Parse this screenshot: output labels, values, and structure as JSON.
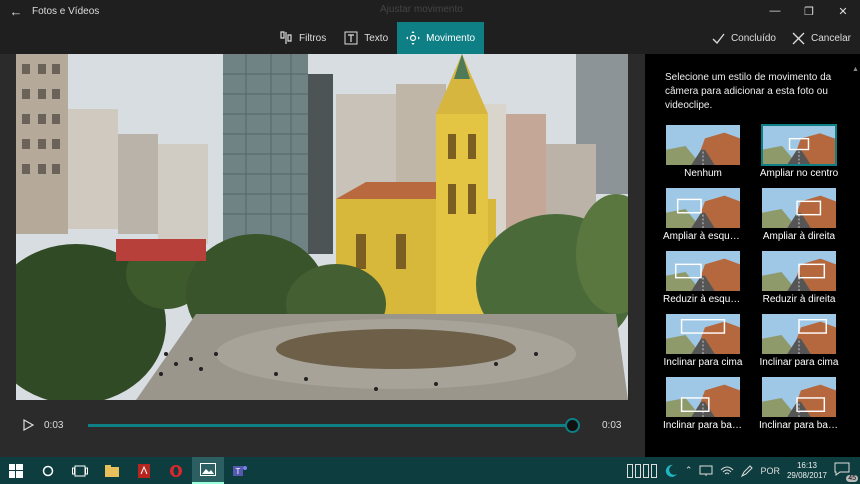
{
  "titlebar": {
    "app_title": "Fotos e Vídeos",
    "ghost_label": "Ajustar movimento",
    "back_icon": "arrow-left-icon",
    "minimize": "—",
    "maximize": "❐",
    "close": "✕"
  },
  "toolbar": {
    "tabs": [
      {
        "label": "Filtros",
        "icon": "filter-icon",
        "active": false
      },
      {
        "label": "Texto",
        "icon": "text-icon",
        "active": false
      },
      {
        "label": "Movimento",
        "icon": "motion-icon",
        "active": true
      }
    ],
    "done_label": "Concluído",
    "cancel_label": "Cancelar"
  },
  "player": {
    "current_time": "0:03",
    "total_time": "0:03",
    "progress_percent": 100
  },
  "panel": {
    "description": "Selecione um estilo de movimento da câmera para adicionar a esta foto ou videoclipe.",
    "styles": [
      {
        "label": "Nenhum",
        "selected": false
      },
      {
        "label": "Ampliar no centro",
        "selected": true
      },
      {
        "label": "Ampliar à esquerda",
        "selected": false
      },
      {
        "label": "Ampliar à direita",
        "selected": false
      },
      {
        "label": "Reduzir à esquerda",
        "selected": false
      },
      {
        "label": "Reduzir à direita",
        "selected": false
      },
      {
        "label": "Inclinar para cima",
        "selected": false
      },
      {
        "label": "Inclinar para cima",
        "selected": false
      },
      {
        "label": "Inclinar para baixo",
        "selected": false
      },
      {
        "label": "Inclinar para baixo",
        "selected": false
      }
    ]
  },
  "taskbar": {
    "language": "POR",
    "time": "16:13",
    "date": "29/08/2017",
    "notification_count": "45"
  },
  "colors": {
    "accent": "#0f7f86",
    "taskbar": "#0e3d3f"
  }
}
